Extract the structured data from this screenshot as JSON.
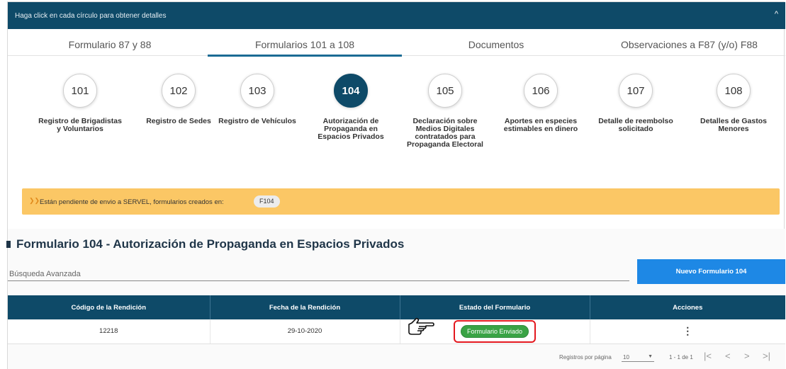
{
  "header": {
    "hint": "Haga click en cada círculo para obtener detalles",
    "collapse_icon": "chevron-up-icon",
    "collapse_glyph": "^",
    "color": "#0e4a68"
  },
  "tabs": [
    {
      "label": "Formulario 87 y 88"
    },
    {
      "label": "Formularios 101 a 108"
    },
    {
      "label": "Documentos"
    },
    {
      "label": "Observaciones a F87 (y/o) F88"
    }
  ],
  "active_tab": "Formularios 101 a 108",
  "forms": [
    {
      "number": "101",
      "label": "Registro de Brigadistas y Voluntarios"
    },
    {
      "number": "102",
      "label": "Registro de Sedes"
    },
    {
      "number": "103",
      "label": "Registro de Vehículos"
    },
    {
      "number": "104",
      "label": "Autorización de Propaganda en Espacios Privados"
    },
    {
      "number": "105",
      "label": "Declaración sobre Medios Digitales contratados para Propaganda Electoral"
    },
    {
      "number": "106",
      "label": "Aportes en especies estimables en dinero"
    },
    {
      "number": "107",
      "label": "Detalle de reembolso solicitado"
    },
    {
      "number": "108",
      "label": "Detalles de Gastos Menores"
    }
  ],
  "active_form": "104",
  "banner": {
    "message": "Están pendiente de envio a SERVEL, formularios creados en:",
    "chip": "F104",
    "color": "#fbc765"
  },
  "section": {
    "title": "Formulario 104 - Autorización de Propaganda en Espacios Privados",
    "search_placeholder": "Búsqueda Avanzada",
    "new_button": "Nuevo Formulario 104"
  },
  "table": {
    "headers": [
      "Código de la Rendición",
      "Fecha de la Rendición",
      "Estado del Formulario",
      "Acciones"
    ],
    "rows": [
      {
        "codigo": "12218",
        "fecha": "29-10-2020",
        "estado": "Formulario Enviado",
        "acciones": "⋮"
      }
    ]
  },
  "pager": {
    "label": "Registros por página",
    "per_page": "10",
    "range": "1 - 1 de 1",
    "first": "|<",
    "prev": "<",
    "next": ">",
    "last": ">|"
  },
  "colors": {
    "accent": "#1e88e5",
    "status_ok": "#3aa345",
    "highlight": "#e3181f"
  }
}
